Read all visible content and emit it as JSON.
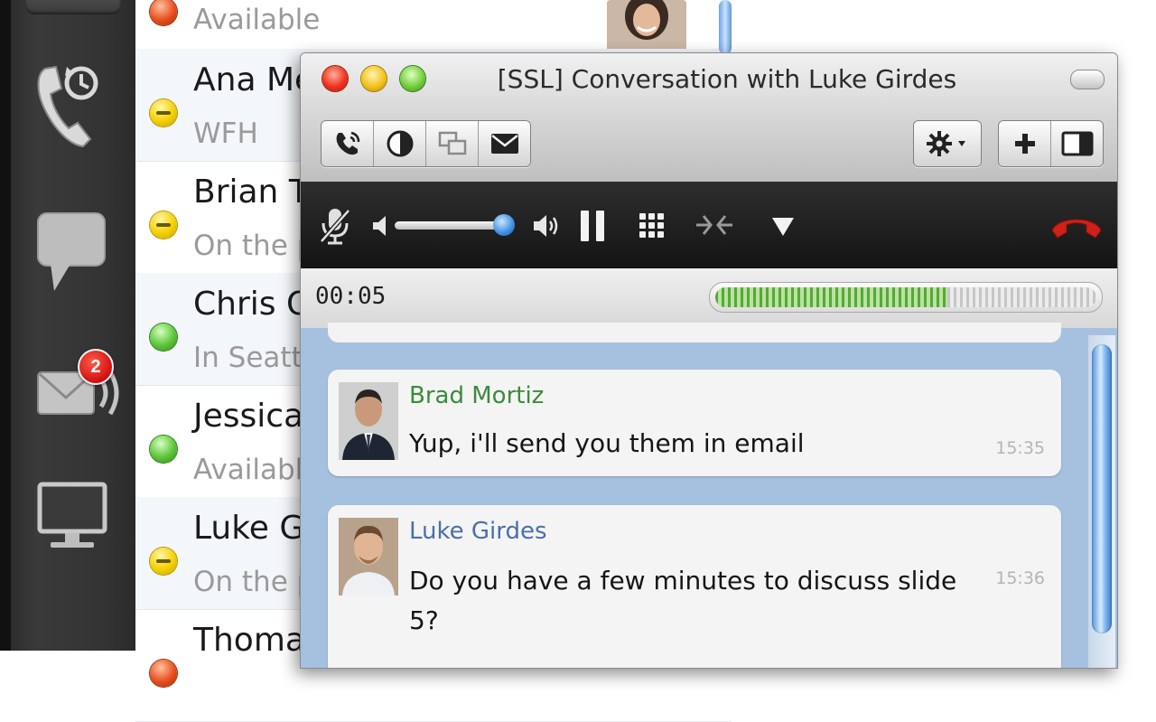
{
  "contacts": [
    {
      "name": "",
      "status": "Available",
      "presence": "busy"
    },
    {
      "name": "Ana Me",
      "status": "WFH",
      "presence": "away"
    },
    {
      "name": "Brian Tr",
      "status": "On the p",
      "presence": "away"
    },
    {
      "name": "Chris Q",
      "status": "In Seattl",
      "presence": "available"
    },
    {
      "name": "Jessica",
      "status": "Available",
      "presence": "available"
    },
    {
      "name": "Luke Gi",
      "status": "On the p",
      "presence": "away"
    },
    {
      "name": "Thomas",
      "status": "",
      "presence": "busy"
    }
  ],
  "rail": {
    "icons": [
      "phone-history-icon",
      "chat-icon",
      "voicemail-icon",
      "screen-share-icon"
    ],
    "voicemail_badge": "2"
  },
  "window": {
    "title": "[SSL] Conversation with Luke Girdes",
    "toolbar_left": [
      "call-icon",
      "contrast-icon",
      "windows-icon",
      "mail-icon"
    ],
    "toolbar_right": [
      "gear-icon",
      "add-icon",
      "sidebar-icon"
    ]
  },
  "call": {
    "controls": [
      "mute-mic-icon",
      "volume-low-icon",
      "volume-high-icon",
      "pause-icon",
      "keypad-icon",
      "merge-icon",
      "dropdown-arrow-icon",
      "hang-up-icon"
    ],
    "volume_level": 0.92,
    "timer": "00:05",
    "signal_level": 0.61
  },
  "messages": [
    {
      "sender": "Brad Mortiz",
      "text": "Yup, i'll send you them in email",
      "time": "15:35",
      "sender_color": "#3c8a3c"
    },
    {
      "sender": "Luke Girdes",
      "text": "Do you have a few minutes to discuss slide 5?",
      "time": "15:36",
      "sender_color": "#4a6fa8"
    }
  ],
  "colors": {
    "rail_bg": "#333333",
    "chat_bg": "#a6c0e0",
    "hangup": "#d0201a",
    "signal": "#56a83a",
    "badge": "#d01010"
  }
}
